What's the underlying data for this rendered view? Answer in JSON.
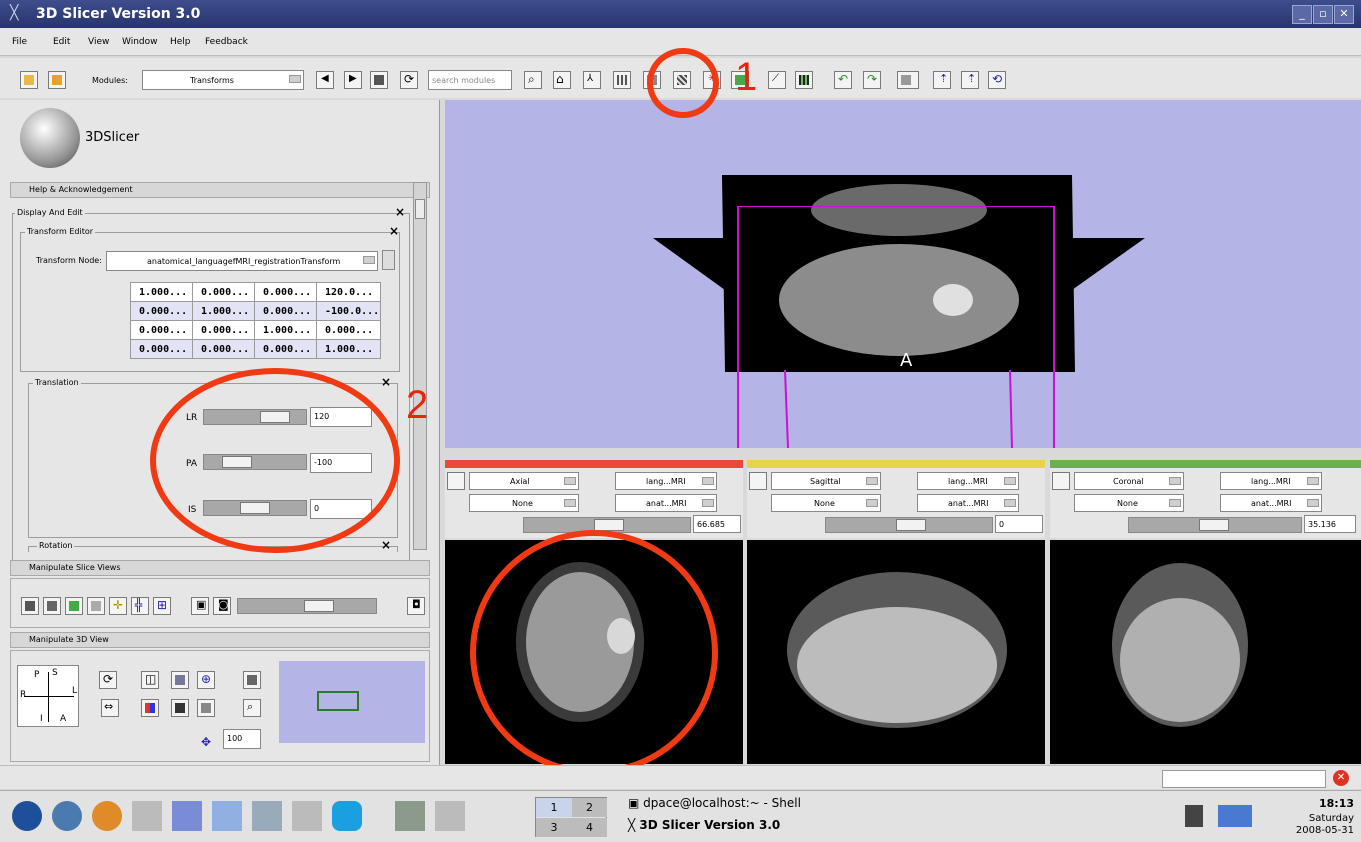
{
  "window": {
    "title": "3D Slicer Version 3.0"
  },
  "menu": [
    "File",
    "Edit",
    "View",
    "Window",
    "Help",
    "Feedback"
  ],
  "toolbar": {
    "modules_label": "Modules:",
    "module_value": "Transforms",
    "search_placeholder": "search modules"
  },
  "logo": {
    "text": "3DSlicer"
  },
  "panels": {
    "help": "Help & Acknowledgement",
    "display_edit": "Display And Edit",
    "transform_editor": "Transform Editor",
    "transform_node_label": "Transform Node:",
    "transform_node_value": "anatomical_languagefMRI_registrationTransform",
    "matrix": [
      [
        "1.000...",
        "0.000...",
        "0.000...",
        "120.0..."
      ],
      [
        "0.000...",
        "1.000...",
        "0.000...",
        "-100.0..."
      ],
      [
        "0.000...",
        "0.000...",
        "1.000...",
        "0.000..."
      ],
      [
        "0.000...",
        "0.000...",
        "0.000...",
        "1.000..."
      ]
    ],
    "translation": "Translation",
    "rotation": "Rotation",
    "sliders": [
      {
        "label": "LR",
        "value": "120",
        "level": 0.75
      },
      {
        "label": "PA",
        "value": "-100",
        "level": 0.25
      },
      {
        "label": "IS",
        "value": "0",
        "level": 0.5
      }
    ],
    "manipulate_slice": "Manipulate Slice Views",
    "manipulate_3d": "Manipulate 3D View",
    "zoom_value": "100",
    "axes": {
      "p": "P",
      "s": "S",
      "r": "R",
      "l": "L",
      "i": "I",
      "a": "A"
    }
  },
  "view3d": {
    "orientation_label": "A",
    "color": "#b4b4e6"
  },
  "slices": [
    {
      "name": "Axial",
      "color": "#e9493b",
      "fg": "lang...MRI",
      "bg": "anat...MRI",
      "label": "None",
      "value": "66.685"
    },
    {
      "name": "Sagittal",
      "color": "#e8d44a",
      "fg": "lang...MRI",
      "bg": "anat...MRI",
      "label": "None",
      "value": "0"
    },
    {
      "name": "Coronal",
      "color": "#6ab04c",
      "fg": "lang...MRI",
      "bg": "anat...MRI",
      "label": "None",
      "value": "35.136"
    }
  ],
  "annotations": {
    "one": "1",
    "two": "2"
  },
  "taskbar": {
    "workspaces": [
      "1",
      "2",
      "3",
      "4"
    ],
    "task1": "dpace@localhost:~ - Shell",
    "task2": "3D Slicer Version 3.0",
    "time": "18:13",
    "day": "Saturday",
    "date": "2008-05-31"
  }
}
